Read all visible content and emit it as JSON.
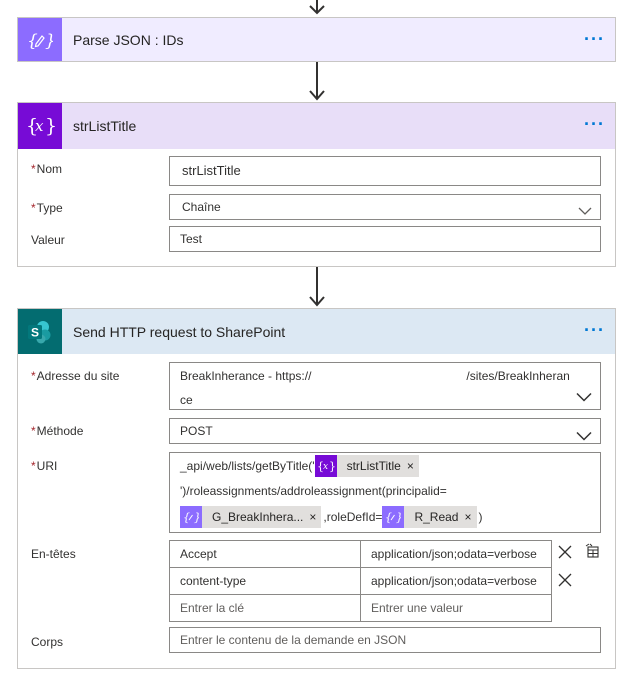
{
  "steps": [
    {
      "title": "Parse JSON : IDs",
      "icon": "braces-pencil-icon",
      "accent": "#8c6cff",
      "header_bg": "#f0ecff"
    },
    {
      "title": "strListTitle",
      "icon": "variable-icon",
      "accent": "#770bd6",
      "header_bg": "#e8def8",
      "fields": {
        "nom_label": "Nom",
        "nom_value": "strListTitle",
        "type_label": "Type",
        "type_value": "Chaîne",
        "valeur_label": "Valeur",
        "valeur_value": "Test"
      }
    },
    {
      "title": "Send HTTP request to SharePoint",
      "icon": "sharepoint-icon",
      "accent": "#036c70",
      "header_bg": "#dce8f3",
      "fields": {
        "site_label": "Adresse du site",
        "site_value_line1": "BreakInherance - https://",
        "site_value_line1_end": "/sites/BreakInheran",
        "site_value_line2": "ce",
        "method_label": "Méthode",
        "method_value": "POST",
        "uri_label": "URI",
        "uri_text1": "_api/web/lists/getByTitle('",
        "uri_token1": "strListTitle",
        "uri_text2": "')/roleassignments/addroleassignment(principalid=",
        "uri_token2": "G_BreakInhera...",
        "uri_text3": ",roleDefId=",
        "uri_token3": "R_Read",
        "uri_text4": ")",
        "headers_label": "En-têtes",
        "headers": [
          {
            "key": "Accept",
            "value": "application/json;odata=verbose"
          },
          {
            "key": "content-type",
            "value": "application/json;odata=verbose"
          }
        ],
        "header_key_placeholder": "Entrer la clé",
        "header_value_placeholder": "Entrer une valeur",
        "body_label": "Corps",
        "body_placeholder": "Entrer le contenu de la demande en JSON"
      }
    }
  ],
  "menu_dots": "···",
  "token_close": "×"
}
